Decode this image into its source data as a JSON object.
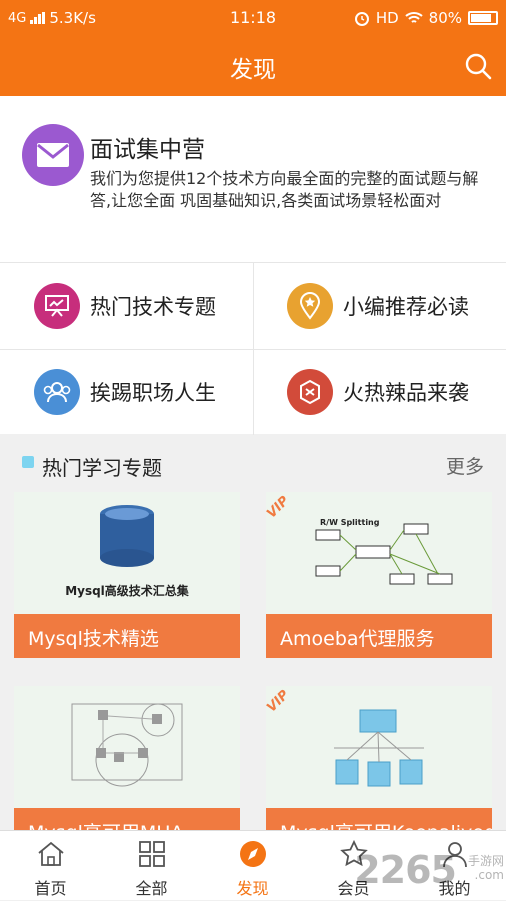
{
  "status_bar": {
    "network": "4G",
    "speed": "5.3K/s",
    "time": "11:18",
    "hd": "HD",
    "battery": "80%"
  },
  "header": {
    "title": "发现"
  },
  "intro": {
    "title": "面试集中营",
    "description": "我们为您提供12个技术方向最全面的完整的面试题与解答,让您全面 巩固基础知识,各类面试场景轻松面对"
  },
  "grid": [
    {
      "label": "热门技术专题",
      "icon": "presentation-icon",
      "color": "#c72e7c"
    },
    {
      "label": "小编推荐必读",
      "icon": "location-star-icon",
      "color": "#e8a230"
    },
    {
      "label": "挨踢职场人生",
      "icon": "people-icon",
      "color": "#4a8fd6"
    },
    {
      "label": "火热辣品来袭",
      "icon": "badge-icon",
      "color": "#d24b3a"
    }
  ],
  "section": {
    "title": "热门学习专题",
    "more": "更多"
  },
  "cards": [
    {
      "label": "Mysql技术精选",
      "image_caption": "Mysql高级技术汇总集",
      "vip": false
    },
    {
      "label": "Amoeba代理服务",
      "image_caption": "R/W Splitting",
      "vip": true
    },
    {
      "label": "Mysql高可用MHA",
      "image_caption": "",
      "vip": false
    },
    {
      "label": "Mysql高可用Keepalived",
      "image_caption": "",
      "vip": true
    }
  ],
  "tabs": [
    {
      "label": "首页",
      "icon": "home-icon"
    },
    {
      "label": "全部",
      "icon": "grid-icon"
    },
    {
      "label": "发现",
      "icon": "compass-icon",
      "active": true
    },
    {
      "label": "会员",
      "icon": "star-icon"
    },
    {
      "label": "我的",
      "icon": "user-icon"
    }
  ],
  "vip_label": "VIP",
  "watermark": {
    "main": "2265",
    "sub1": "手游网",
    "sub2": ".com"
  },
  "colors": {
    "accent": "#f47414",
    "card_label": "#f07a40"
  }
}
